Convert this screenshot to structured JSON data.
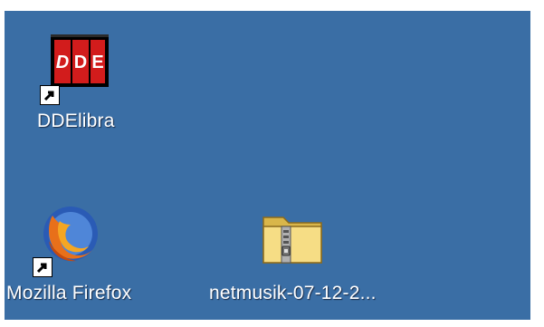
{
  "desktop": {
    "background_color": "#3a6ea5",
    "icons": [
      {
        "label": "DDElibra",
        "image": "ddelibra-app-icon",
        "badge": "shortcut-arrow-icon",
        "logo_text": "DDE"
      },
      {
        "label": "Mozilla Firefox",
        "image": "firefox-icon",
        "badge": "shortcut-arrow-icon"
      },
      {
        "label": "netmusik-07-12-2...",
        "image": "zip-folder-icon"
      }
    ]
  }
}
